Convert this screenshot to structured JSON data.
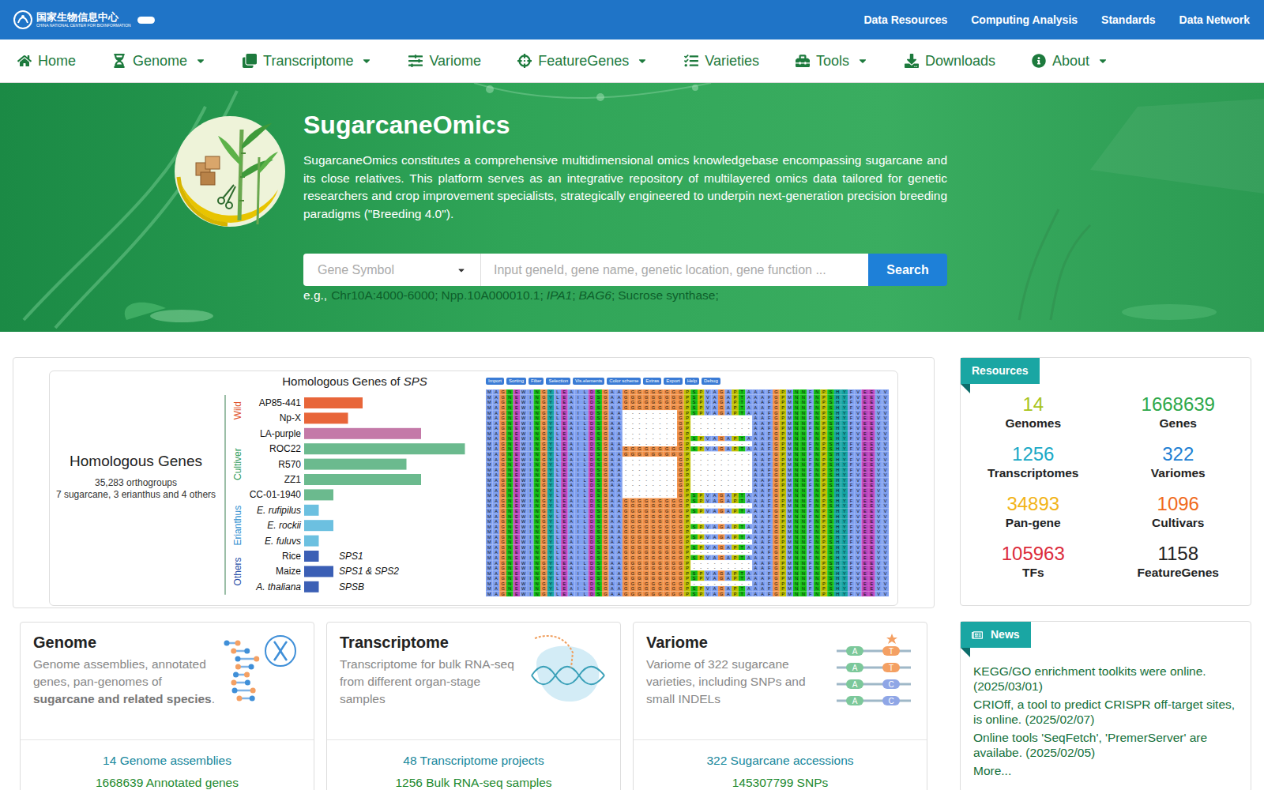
{
  "topbar": {
    "logo_cn": "国家生物信息中心",
    "logo_en": "CHINA NATIONAL CENTER FOR BIOINFORMATION",
    "links": [
      "Data Resources",
      "Computing Analysis",
      "Standards",
      "Data Network"
    ]
  },
  "nav": [
    {
      "label": "Home",
      "dropdown": false
    },
    {
      "label": "Genome",
      "dropdown": true
    },
    {
      "label": "Transcriptome",
      "dropdown": true
    },
    {
      "label": "Variome",
      "dropdown": false
    },
    {
      "label": "FeatureGenes",
      "dropdown": true
    },
    {
      "label": "Varieties",
      "dropdown": false
    },
    {
      "label": "Tools",
      "dropdown": true
    },
    {
      "label": "Downloads",
      "dropdown": false
    },
    {
      "label": "About",
      "dropdown": true
    }
  ],
  "hero": {
    "title": "SugarcaneOmics",
    "description": "SugarcaneOmics constitutes a comprehensive multidimensional omics knowledgebase encompassing sugarcane and its close relatives. This platform serves as an integrative repository of multilayered omics data tailored for genetic researchers and crop improvement specialists, strategically engineered to underpin next-generation precision breeding paradigms (\"Breeding 4.0\").",
    "search": {
      "select": "Gene Symbol",
      "placeholder": "Input geneId, gene name, genetic location, gene function ...",
      "button": "Search"
    },
    "examples_prefix": "e.g.,",
    "separator": ";",
    "examples": [
      {
        "text": "Chr10A:4000-6000",
        "italic": false
      },
      {
        "text": "Npp.10A000010.1",
        "italic": false
      },
      {
        "text": "IPA1",
        "italic": true
      },
      {
        "text": "BAG6",
        "italic": true
      },
      {
        "text": "Sucrose synthase",
        "italic": false
      }
    ]
  },
  "figure": {
    "summary": {
      "title": "Homologous Genes",
      "line1": "35,283 orthogroups",
      "line2": "7 sugarcane, 3 erianthus and 4 others"
    },
    "chart": {
      "title_prefix": "Homologous Genes of ",
      "title_gene": "SPS",
      "groups": [
        {
          "label": "Wild",
          "color": "#e0552e",
          "bars": [
            {
              "label": "AP85-441",
              "value": 4,
              "color": "#e8663a",
              "italic": false,
              "note": ""
            },
            {
              "label": "Np-X",
              "value": 3,
              "color": "#e8663a",
              "italic": false,
              "note": ""
            }
          ]
        },
        {
          "label": "Cultiver",
          "color": "#2e9a58",
          "bars": [
            {
              "label": "LA-purple",
              "value": 8,
              "color": "#c479a8",
              "italic": false,
              "note": ""
            },
            {
              "label": "ROC22",
              "value": 11,
              "color": "#6bba8e",
              "italic": false,
              "note": ""
            },
            {
              "label": "R570",
              "value": 7,
              "color": "#6bba8e",
              "italic": false,
              "note": ""
            },
            {
              "label": "ZZ1",
              "value": 8,
              "color": "#6bba8e",
              "italic": false,
              "note": ""
            },
            {
              "label": "CC-01-1940",
              "value": 2,
              "color": "#6bba8e",
              "italic": false,
              "note": ""
            }
          ]
        },
        {
          "label": "Erianthus",
          "color": "#2e8fd0",
          "bars": [
            {
              "label": "E. rufipilus",
              "value": 1,
              "color": "#6cc0e0",
              "italic": true,
              "note": ""
            },
            {
              "label": "E. rockii",
              "value": 2,
              "color": "#6cc0e0",
              "italic": true,
              "note": ""
            },
            {
              "label": "E. fuluvs",
              "value": 1,
              "color": "#6cc0e0",
              "italic": true,
              "note": ""
            }
          ]
        },
        {
          "label": "Others",
          "color": "#2a4fa8",
          "bars": [
            {
              "label": "Rice",
              "value": 1,
              "color": "#3b5fb5",
              "italic": false,
              "note": "SPS1"
            },
            {
              "label": "Maize",
              "value": 2,
              "color": "#3b5fb5",
              "italic": false,
              "note": "SPS1 & SPS2"
            },
            {
              "label": "A. thaliana",
              "value": 1,
              "color": "#3b5fb5",
              "italic": true,
              "note": "SPSB"
            }
          ]
        }
      ]
    },
    "alignment": {
      "toolbar": [
        "Import",
        "Sorting",
        "Filter",
        "Selection",
        "Vis.elements",
        "Color scheme",
        "Extras",
        "Export",
        "Help",
        "Debug"
      ],
      "sequences": [
        "MAGNEWINGYLEAILDSGAAGGGGGGGGGPSPVAGAPTAAAFGPMNNFNPSHYFVEEVV",
        "MAGNEWINGYLEAILDSGAAGGGGGGGGGPSPVAGAPTAAAFGPMNNFNPSHYFVEEVV",
        "MAGNEWINGYLEAILDSGAAGGGGGGGGGPSPVAGAPTAAAFGPMNNFNPSHYFVEEVV",
        "MAGNEWINGYLEAILDSGAAGGGGGGGGGPSPVAGAPTAAAFGPMNNFNPSHYFVEEVV",
        "MAGNEWINGYLEAILDSGAA--------GPSPVAGAPTAAAFGPMNNFNPSHYFVEEVV",
        "MAGNEWINGYLEAILDSGAA--------GP---------AAFGPMNNFNPSHYFVEEVV",
        "MAGNEWINGYLEAILDSGAA--------GP---------AAFGPMNNFNPSHYFVEEVV",
        "MAGNEWINGYLEAILDSGAA--------GP---------AAFGPMNNFNPSHYFVEEVV",
        "MAGNEWINGYLEAILDSGAA--------GP---------AAFGPMNNFNPSHYFVEEVV",
        "MAGNEWINGYLEAILDSGAA--------GPSPVAGAPTAAAFGPMNNFNPSHYFVEEVV",
        "MAGNEWINGYLEAILDSGAA--------GP---------AAFGPMNNFNPSHYFVEEVV",
        "MAGNEWINGYLEAILDSGAAGGGGGGGGGPSPVAGAPTAAAFGPMNNFNPSHYFVEEVV",
        "MAGNEWINGYLEAILDSGAAGGGGGGGGGP---------AAFGPMNNFNPSHYFVEEVV",
        "MAGNEWINGYLEAILDSGAA--------GP---------AAFGPMNNFNPSHYFVEEVV",
        "MAGNEWINGYLEAILDSGAA--------GP---------AAFGPMNNFNPSHYFVEEVV",
        "MAGNEWINGYLEAILDSGAA--------GP---------AAFGPMNNFNPSHYFVEEVV",
        "MAGNEWINGYLEAILDSGAA--------GP---------AAFGPMNNFNPSHYFVEEVV",
        "MAGNEWINGYLEAILDSGAA--------GP---------AAFGPMNNFNPSHYFVEEVV",
        "MAGNEWINGYLEAILDSGAA--------GP---------AAFGPMNNFNPSHYFVEEVV",
        "MAGNEWINGYLEAILDSGAA--------GP---------AAFGPMNNFNPSHYFVEEVV",
        "MAGNEWINGYLEAILDSGAA--------GPSPVAGAPTAAAFGPMNNFNPSHYFVEEVV",
        "MAGNEWINGYLEAILDSGAAGGGGGGGGGPSPVAGAPTAAAFGPMNNFNPSHYFVEEVV",
        "MAGNEWINGYLEAILDSGAAGGGGGGGGGP---------AAFGPMNNFNPSHYFVEEVV",
        "MAGNEWINGYLEAILDSGAAGGGGGGGGGPSPVAGAPTAAAFGPMNNFNPSHYFVEEVV",
        "MAGNEWINGYLEAILDSGAAGGGGGGGGGP---------AAFGPMNNFNPSHYFVEEVV",
        "MAGNEWINGYLEAILDSGAAGGGGGGGGGP---------AAFGPMNNFNPSHYFVEEVV",
        "MAGNEWINGYLEAILDSGAAGGGGGGGGGPSPVAGAPTAAAFGPMNNFNPSHYFVEEVV",
        "MAGNEWINGYLEAILDSGAAGGGGGGGGGP---------AAFGPMNNFNPSHYFVEEVV",
        "MAGNEWINGYLEAILDSGAAGGGGGGGGGPSPVAGAPTAAAFGPMNNFNPSHYFVEEVV",
        "MAGNEWINGYLEAILDSGAAGGGGGGGGGP---------AAFGPMNNFNPSHYFVEEVV",
        "MAGNEWINGYLEAILDSGAAGGGGGGGGGPSPVAGAPTAAAFGPMNNFNPSHYFVEEVV",
        "MAGNEWINGYLEAILDSGAAGGGGGGGGGP---------AAFGPMNNFNPSHYFVEEVV",
        "MAGNEWINGYLEAILDSGAAGGGGGGGGGPSPVAGAPTAAAFGPMNNFNPSHYFVEEVV",
        "MAGNEWINGYLEAILDSGAAGGGGGGGGGP---------AAFGPMNNFNPSHYFVEEVV",
        "MAGNEWINGYLEAILDSGAAGGGGGGGGGP---------AAFGPMNNFNPSHYFVEEVV",
        "MAGNEWINGYLEAILDSGAAGGGGGGGGGPSPVAGAPTAAAFGPMNNFNPSHYFVEEVV",
        "MAGNEWINGYLEAILDSGAAGGGGGGGGGPSPVAGAPTAAAFGPMNNFNPSHYFVEEVV",
        "MAGNEWINGYLEAILDSGAAGGGGGGGGGP---------AAFGPMNNFNPSHYFVEEVV",
        "MAGNEWINGYLEAILDSGAAGGGGGGGGGPSPVAGAPTAAAFGPMNNFNPSHYFVEEVV",
        "MAGNEWINGYLEAILDSGAAGGGGGGGGGPSPVAGAPTAAAFGPMNNFNPSHYFVEEVV"
      ]
    }
  },
  "resources": {
    "tag": "Resources",
    "stats": [
      {
        "value": "14",
        "label": "Genomes",
        "color": "#a8c41c"
      },
      {
        "value": "1668639",
        "label": "Genes",
        "color": "#2ea84a"
      },
      {
        "value": "1256",
        "label": "Transcriptomes",
        "color": "#19a9c6"
      },
      {
        "value": "322",
        "label": "Variomes",
        "color": "#1e7fd3"
      },
      {
        "value": "34893",
        "label": "Pan-gene",
        "color": "#f2b418"
      },
      {
        "value": "1096",
        "label": "Cultivars",
        "color": "#f06a1c"
      },
      {
        "value": "105963",
        "label": "TFs",
        "color": "#dc2b3b"
      },
      {
        "value": "1158",
        "label": "FeatureGenes",
        "color": "#222222"
      }
    ]
  },
  "cards": [
    {
      "kind": "genome",
      "title": "Genome",
      "desc": [
        {
          "text": "Genome assemblies, annotated genes, pan-genomes of ",
          "bold": false
        },
        {
          "text": "sugarcane and related species",
          "bold": true
        },
        {
          "text": ".",
          "bold": false
        }
      ],
      "links": [
        {
          "text": "14 Genome assemblies",
          "color": "#17879c"
        },
        {
          "text": "1668639 Annotated genes",
          "color": "#1e8a2e"
        }
      ]
    },
    {
      "kind": "transcriptome",
      "title": "Transcriptome",
      "desc": [
        {
          "text": "Transcriptome for bulk RNA-seq from different organ-stage samples",
          "bold": false
        }
      ],
      "links": [
        {
          "text": "48 Transcriptome projects",
          "color": "#17879c"
        },
        {
          "text": "1256 Bulk RNA-seq samples",
          "color": "#1e8a2e"
        }
      ]
    },
    {
      "kind": "variome",
      "title": "Variome",
      "desc": [
        {
          "text": "Variome of 322 sugarcane varieties, including SNPs and small INDELs",
          "bold": false
        }
      ],
      "links": [
        {
          "text": "322 Sugarcane accessions",
          "color": "#17879c"
        },
        {
          "text": "145307799 SNPs",
          "color": "#1e8a2e"
        }
      ],
      "illustration": [
        {
          "ref": "A",
          "alt": "T",
          "alt_color": "#f4a063"
        },
        {
          "ref": "A",
          "alt": "T",
          "alt_color": "#f4a063"
        },
        {
          "ref": "A",
          "alt": "C",
          "alt_color": "#8fa6e6"
        },
        {
          "ref": "A",
          "alt": "C",
          "alt_color": "#8fa6e6"
        }
      ]
    }
  ],
  "news": {
    "tag": "News",
    "items": [
      "KEGG/GO enrichment toolkits were online. (2025/03/01)",
      "CRIOff, a tool to predict CRISPR off-target sites, is online. (2025/02/07)",
      "Online tools 'SeqFetch', 'PremerServer' are availabe. (2025/02/05)"
    ],
    "more": "More..."
  }
}
